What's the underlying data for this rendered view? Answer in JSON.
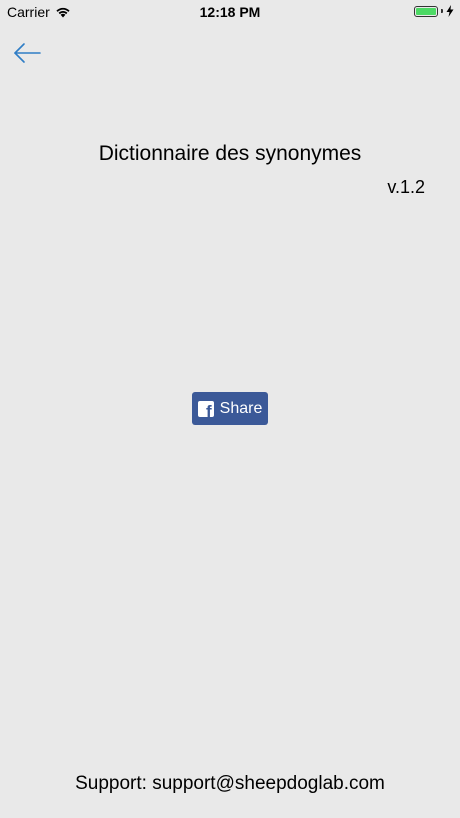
{
  "status_bar": {
    "carrier": "Carrier",
    "time": "12:18 PM",
    "battery_color": "#4cd964"
  },
  "nav": {
    "back_icon": "arrow-left-icon",
    "accent_color": "#2f7dc6"
  },
  "main": {
    "title": "Dictionnaire des synonymes",
    "version": "v.1.2",
    "share": {
      "label": "Share",
      "icon": "facebook-icon",
      "color": "#3b5998"
    }
  },
  "footer": {
    "support_text": "Support: support@sheepdoglab.com"
  }
}
